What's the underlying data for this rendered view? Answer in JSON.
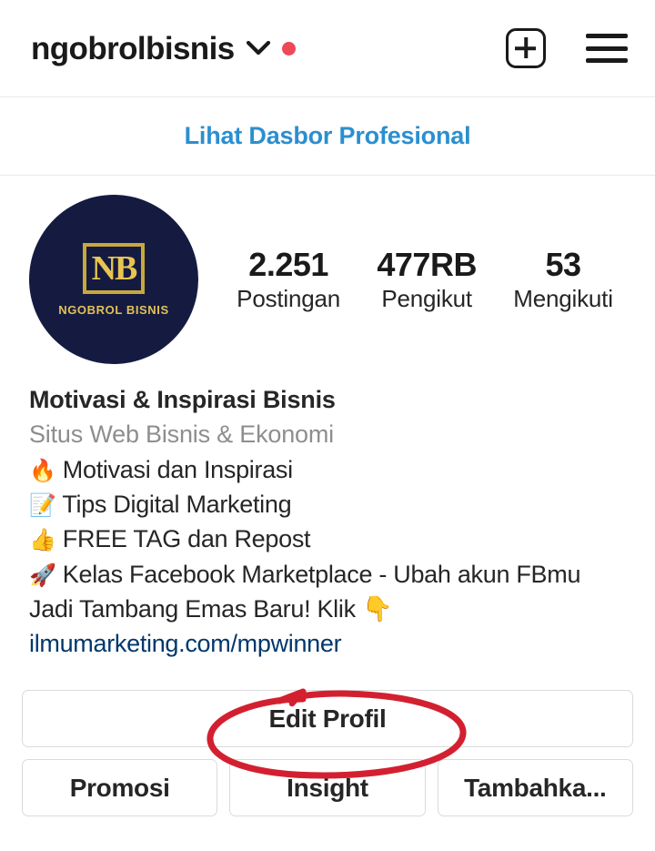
{
  "header": {
    "username": "ngobrolbisnis",
    "dropdown_icon": "chevron-down-icon",
    "notification_dot": true,
    "notification_color": "#ED4956",
    "create_icon": "plus-box-icon",
    "menu_icon": "hamburger-menu-icon"
  },
  "dashboard": {
    "label": "Lihat Dasbor Profesional",
    "color": "#2b8fd0"
  },
  "profile": {
    "avatar": {
      "monogram": "NB",
      "brand_name": "NGOBROL BISNIS",
      "background_color": "#151B40",
      "accent_color": "#E8C551"
    },
    "stats": [
      {
        "value": "2.251",
        "label": "Postingan"
      },
      {
        "value": "477RB",
        "label": "Pengikut"
      },
      {
        "value": "53",
        "label": "Mengikuti"
      }
    ],
    "bio_name": "Motivasi & Inspirasi Bisnis",
    "bio_category": "Situs Web Bisnis & Ekonomi",
    "bio_lines": [
      {
        "emoji": "🔥",
        "emoji_name": "fire-emoji",
        "text": "Motivasi dan Inspirasi"
      },
      {
        "emoji": "📝",
        "emoji_name": "memo-emoji",
        "text": "Tips Digital Marketing"
      },
      {
        "emoji": "👍",
        "emoji_name": "thumbs-up-emoji",
        "text": "FREE TAG dan Repost"
      },
      {
        "emoji": "🚀",
        "emoji_name": "rocket-emoji",
        "text": "Kelas Facebook Marketplace - Ubah akun FBmu"
      },
      {
        "emoji": "",
        "emoji_name": "",
        "text": "Jadi Tambang Emas Baru! Klik 👇"
      }
    ],
    "bio_link": "ilmumarketing.com/mpwinner",
    "bio_link_color": "#00376b"
  },
  "actions": {
    "edit_profile": "Edit Profil",
    "promote": "Promosi",
    "insight": "Insight",
    "add": "Tambahka..."
  },
  "annotation": {
    "shape": "hand-drawn-red-ellipse",
    "color": "#D32030",
    "targets": "Edit Profil"
  }
}
